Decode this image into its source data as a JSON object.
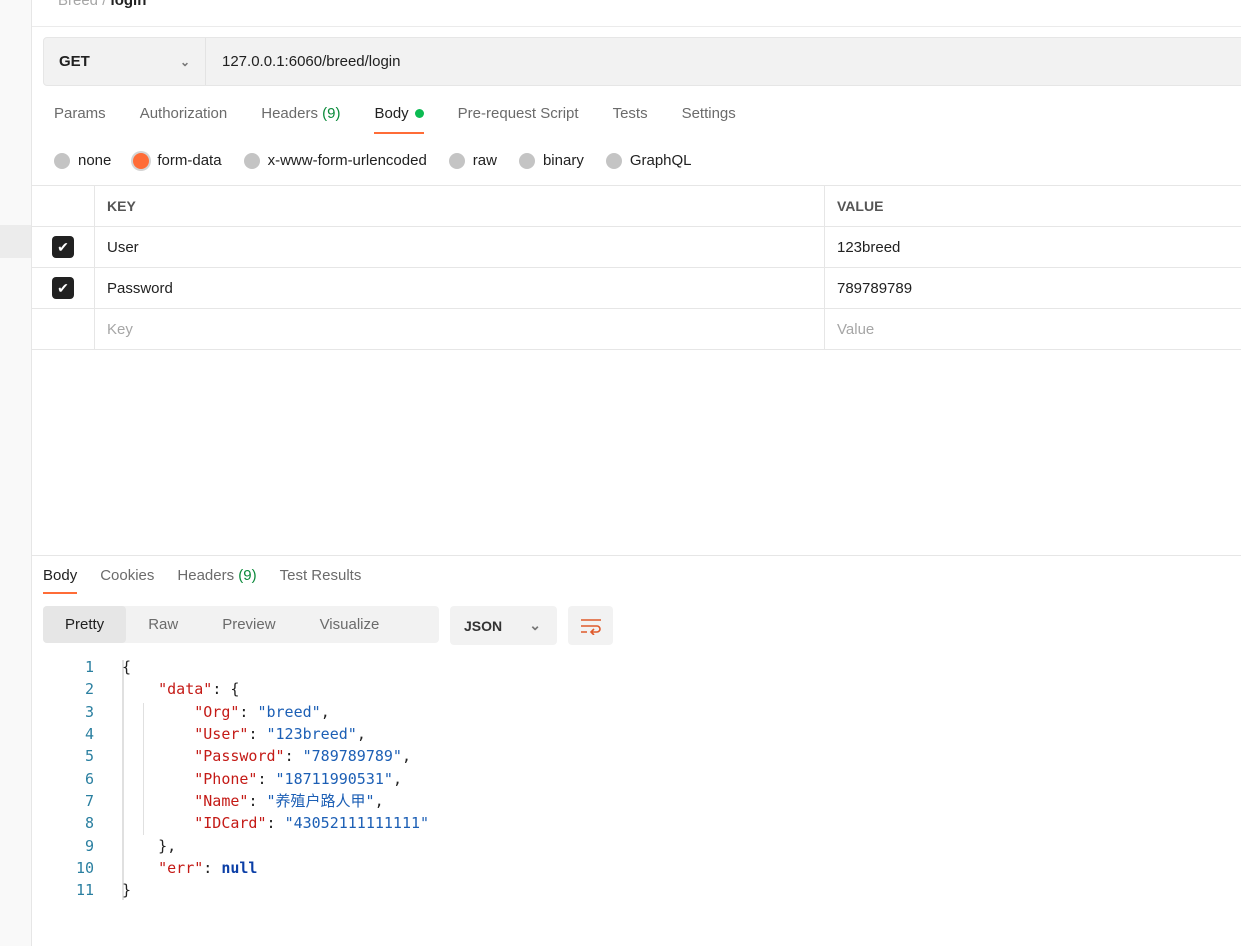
{
  "breadcrumb": {
    "parent": "Breed",
    "current": "login"
  },
  "request": {
    "method": "GET",
    "url": "127.0.0.1:6060/breed/login"
  },
  "tabs": [
    {
      "label": "Params"
    },
    {
      "label": "Authorization"
    },
    {
      "label": "Headers",
      "count": "(9)"
    },
    {
      "label": "Body",
      "active": true
    },
    {
      "label": "Pre-request Script"
    },
    {
      "label": "Tests"
    },
    {
      "label": "Settings"
    }
  ],
  "body_types": [
    {
      "label": "none"
    },
    {
      "label": "form-data",
      "selected": true
    },
    {
      "label": "x-www-form-urlencoded"
    },
    {
      "label": "raw"
    },
    {
      "label": "binary"
    },
    {
      "label": "GraphQL"
    }
  ],
  "table": {
    "headers": {
      "key": "KEY",
      "value": "VALUE"
    },
    "rows": [
      {
        "checked": true,
        "key": "User",
        "value": "123breed"
      },
      {
        "checked": true,
        "key": "Password",
        "value": "789789789"
      }
    ],
    "placeholder": {
      "key": "Key",
      "value": "Value"
    }
  },
  "response": {
    "tabs": [
      {
        "label": "Body",
        "active": true
      },
      {
        "label": "Cookies"
      },
      {
        "label": "Headers",
        "count": "(9)"
      },
      {
        "label": "Test Results"
      }
    ],
    "views": [
      "Pretty",
      "Raw",
      "Preview",
      "Visualize"
    ],
    "format": "JSON",
    "lines": [
      {
        "n": "1",
        "t": "{"
      },
      {
        "n": "2",
        "t": "    ",
        "k": "\"data\"",
        "p": ": {"
      },
      {
        "n": "3",
        "t": "        ",
        "k": "\"Org\"",
        "p": ": ",
        "s": "\"breed\"",
        "e": ","
      },
      {
        "n": "4",
        "t": "        ",
        "k": "\"User\"",
        "p": ": ",
        "s": "\"123breed\"",
        "e": ","
      },
      {
        "n": "5",
        "t": "        ",
        "k": "\"Password\"",
        "p": ": ",
        "s": "\"789789789\"",
        "e": ","
      },
      {
        "n": "6",
        "t": "        ",
        "k": "\"Phone\"",
        "p": ": ",
        "s": "\"18711990531\"",
        "e": ","
      },
      {
        "n": "7",
        "t": "        ",
        "k": "\"Name\"",
        "p": ": ",
        "s": "\"养殖户路人甲\"",
        "e": ","
      },
      {
        "n": "8",
        "t": "        ",
        "k": "\"IDCard\"",
        "p": ": ",
        "s": "\"43052111111111\""
      },
      {
        "n": "9",
        "t": "    },"
      },
      {
        "n": "10",
        "t": "    ",
        "k": "\"err\"",
        "p": ": ",
        "v": "null"
      },
      {
        "n": "11",
        "t": "}"
      }
    ]
  },
  "colors": {
    "accent": "#ff6c37",
    "green": "#0cbb52"
  }
}
